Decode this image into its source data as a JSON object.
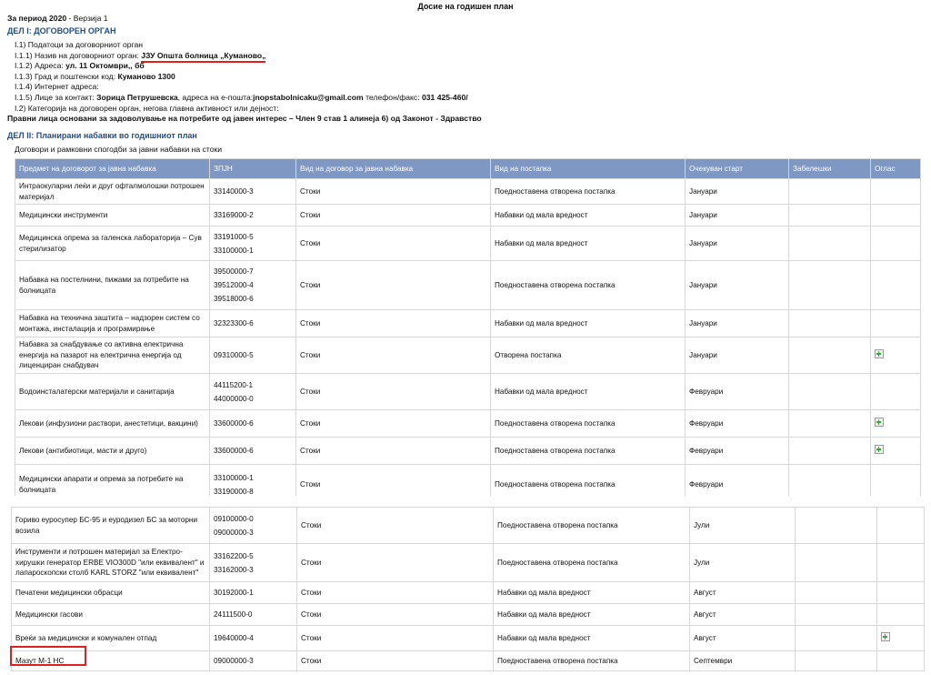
{
  "doc_title": "Досие на годишен план",
  "period_label": "За период 2020",
  "version_text": "- Верзија 1",
  "part1_title": "ДЕЛ I: ДОГОВОРЕН ОРГАН",
  "part1_lines": {
    "l1": "I.1) Податоци за договорниот орган",
    "l2_label": "I.1.1) Назив на договорниот орган: ",
    "l2_value": "ЈЗУ Општа болница „Куманово„",
    "l3_label": "I.1.2) Адреса: ",
    "l3_value": "ул. 11 Октомври,, бб",
    "l4_label": "I.1.3) Град и поштенски код: ",
    "l4_value": "Куманово 1300",
    "l5": "I.1.4) Интернет адреса:",
    "l6_label": "I.1.5) Лице за контакт: ",
    "l6_name": "Зорица Петрушевска",
    "l6_mid": ", адреса на е-пошта:",
    "l6_email": "jnopstabolnicaku@gmail.com",
    "l6_tel_label": " телефон/факс: ",
    "l6_tel": "031 425-460/",
    "l7": "I.2) Категорија на договорен орган, негова главна активност или дејност:",
    "l8": "Правни лица основани за задоволување на потребите од јавен интерес – Член 9 став 1 алинеја 6) од Законот - Здравство"
  },
  "part2_title": "ДЕЛ II: Планирани набавки во годишниот план",
  "part2_sub": "Договори и рамковни спогодби за јавни набавки на стоки",
  "table": {
    "headers": [
      "Предмет на договорот за јавна набавка",
      "ЗПЈН",
      "Вид на договор за јавна набавка",
      "Вид на постапка",
      "Очекуван старт",
      "Забелешки",
      "Оглас"
    ],
    "rows1": [
      {
        "subject": "Интраокуларни леќи и друг офталмолошки потрошен материјал",
        "codes": [
          "33140000-3"
        ],
        "type": "Стоки",
        "procedure": "Поедноставена отворена постапка",
        "start": "Јануари",
        "notes": "",
        "ad": false
      },
      {
        "subject": "Медицински инструменти",
        "codes": [
          "33169000-2"
        ],
        "type": "Стоки",
        "procedure": "Набавки од мала вредност",
        "start": "Јануари",
        "notes": "",
        "ad": false
      },
      {
        "subject": "Медицинска опрема за галенска лабораторија – Сув стерилизатор",
        "codes": [
          "33191000-5",
          "33100000-1"
        ],
        "type": "Стоки",
        "procedure": "Набавки од мала вредност",
        "start": "Јануари",
        "notes": "",
        "ad": false
      },
      {
        "subject": "Набавка на постелнини, пижами за потребите на болницата",
        "codes": [
          "39500000-7",
          "39512000-4",
          "39518000-6"
        ],
        "type": "Стоки",
        "procedure": "Поедноставена отворена постапка",
        "start": "Јануари",
        "notes": "",
        "ad": false
      },
      {
        "subject": "Набавка на технична заштита – надзорен систем со монтажа, инсталација и програмирање",
        "codes": [
          "32323300-6"
        ],
        "type": "Стоки",
        "procedure": "Набавки од мала вредност",
        "start": "Јануари",
        "notes": "",
        "ad": false
      },
      {
        "subject": "Набавка за снабдување со активна електрична енергија на пазарот на електрична енергија од лиценциран снабдувач",
        "codes": [
          "09310000-5"
        ],
        "type": "Стоки",
        "procedure": "Отворена постапка",
        "start": "Јануари",
        "notes": "",
        "ad": true
      },
      {
        "subject": "Водоинсталатерски материјали и санитарија",
        "codes": [
          "44115200-1",
          "44000000-0"
        ],
        "type": "Стоки",
        "procedure": "Набавки од мала вредност",
        "start": "Февруари",
        "notes": "",
        "ad": false
      },
      {
        "subject": "Лекови (инфузиони раствори, анестетици, вакцини)",
        "codes": [
          "33600000-6"
        ],
        "type": "Стоки",
        "procedure": "Поедноставена отворена постапка",
        "start": "Февруари",
        "notes": "",
        "ad": true
      },
      {
        "subject": "Лекови (антибиотици, масти и друго)",
        "codes": [
          "33600000-6"
        ],
        "type": "Стоки",
        "procedure": "Поедноставена отворена постапка",
        "start": "Февруари",
        "notes": "",
        "ad": true
      },
      {
        "subject": "Медицински апарати и опрема за потребите на болницата",
        "codes": [
          "33100000-1",
          "33190000-8"
        ],
        "type": "Стоки",
        "procedure": "Поедноставена отворена постапка",
        "start": "Февруари",
        "notes": "",
        "ad": false
      }
    ],
    "rows2": [
      {
        "subject": "Гориво еуросупер БС-95 и еуродизел БС за моторни возила",
        "codes": [
          "09100000-0",
          "09000000-3"
        ],
        "type": "Стоки",
        "procedure": "Поедноставена отворена постапка",
        "start": "Јули",
        "notes": "",
        "ad": false
      },
      {
        "subject": "Инструменти и потрошен материјал за Електро-хирушки генератор ERBE VIO300D \"или еквивалент\" и лапароскопски столб KARL STORZ \"или еквивалент\"",
        "codes": [
          "33162200-5",
          "33162000-3"
        ],
        "type": "Стоки",
        "procedure": "Поедноставена отворена постапка",
        "start": "Јули",
        "notes": "",
        "ad": false
      },
      {
        "subject": "Печатени медицински обрасци",
        "codes": [
          "30192000-1"
        ],
        "type": "Стоки",
        "procedure": "Набавки од мала вредност",
        "start": "Август",
        "notes": "",
        "ad": false
      },
      {
        "subject": "Медицински гасови",
        "codes": [
          "24111500-0"
        ],
        "type": "Стоки",
        "procedure": "Набавки од мала вредност",
        "start": "Август",
        "notes": "",
        "ad": false
      },
      {
        "subject": "Вреќи за медицински и комунален отпад",
        "codes": [
          "19640000-4"
        ],
        "type": "Стоки",
        "procedure": "Набавки од мала вредност",
        "start": "Август",
        "notes": "",
        "ad": true
      },
      {
        "subject": "Мазут М-1 НС",
        "codes": [
          "09000000-3"
        ],
        "type": "Стоки",
        "procedure": "Поедноставена отворена постапка",
        "start": "Септември",
        "notes": "",
        "ad": false
      }
    ]
  }
}
